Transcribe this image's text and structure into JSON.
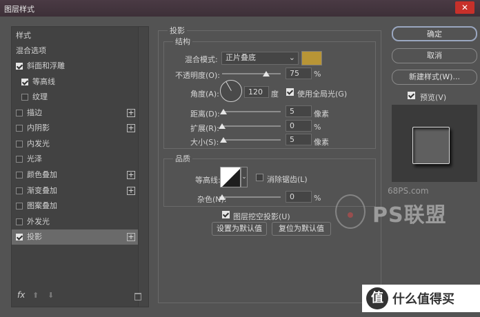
{
  "window": {
    "title": "图层样式",
    "close": "✕"
  },
  "left_panel": {
    "items": [
      {
        "label": "样式",
        "has_checkbox": false,
        "checked": false,
        "has_plus": false,
        "selected": false,
        "indent": 0
      },
      {
        "label": "混合选项",
        "has_checkbox": false,
        "checked": false,
        "has_plus": false,
        "selected": false,
        "indent": 0
      },
      {
        "label": "斜面和浮雕",
        "has_checkbox": true,
        "checked": true,
        "has_plus": false,
        "selected": false,
        "indent": 0
      },
      {
        "label": "等高线",
        "has_checkbox": true,
        "checked": true,
        "has_plus": false,
        "selected": false,
        "indent": 1
      },
      {
        "label": "纹理",
        "has_checkbox": true,
        "checked": false,
        "has_plus": false,
        "selected": false,
        "indent": 1
      },
      {
        "label": "描边",
        "has_checkbox": true,
        "checked": false,
        "has_plus": true,
        "selected": false,
        "indent": 0
      },
      {
        "label": "内阴影",
        "has_checkbox": true,
        "checked": false,
        "has_plus": true,
        "selected": false,
        "indent": 0
      },
      {
        "label": "内发光",
        "has_checkbox": true,
        "checked": false,
        "has_plus": false,
        "selected": false,
        "indent": 0
      },
      {
        "label": "光泽",
        "has_checkbox": true,
        "checked": false,
        "has_plus": false,
        "selected": false,
        "indent": 0
      },
      {
        "label": "颜色叠加",
        "has_checkbox": true,
        "checked": false,
        "has_plus": true,
        "selected": false,
        "indent": 0
      },
      {
        "label": "渐变叠加",
        "has_checkbox": true,
        "checked": false,
        "has_plus": true,
        "selected": false,
        "indent": 0
      },
      {
        "label": "图案叠加",
        "has_checkbox": true,
        "checked": false,
        "has_plus": false,
        "selected": false,
        "indent": 0
      },
      {
        "label": "外发光",
        "has_checkbox": true,
        "checked": false,
        "has_plus": false,
        "selected": false,
        "indent": 0
      },
      {
        "label": "投影",
        "has_checkbox": true,
        "checked": true,
        "has_plus": true,
        "selected": true,
        "indent": 0
      }
    ],
    "fx_label": "fx",
    "up": "⬆",
    "down": "⬇"
  },
  "drop_shadow": {
    "section_title": "投影",
    "structure": {
      "title": "结构",
      "blend_mode_label": "混合模式:",
      "blend_mode_value": "正片叠底",
      "color": "#b89536",
      "opacity_label": "不透明度(O):",
      "opacity_value": "75",
      "opacity_unit": "%",
      "opacity_fraction": 0.75,
      "angle_label": "角度(A):",
      "angle_value": "120",
      "angle_unit": "度",
      "global_light_label": "使用全局光(G)",
      "global_light_checked": true,
      "distance_label": "距离(D):",
      "distance_value": "5",
      "distance_unit": "像素",
      "distance_fraction": 0.02,
      "spread_label": "扩展(R):",
      "spread_value": "0",
      "spread_unit": "%",
      "spread_fraction": 0.0,
      "size_label": "大小(S):",
      "size_value": "5",
      "size_unit": "像素",
      "size_fraction": 0.02
    },
    "quality": {
      "title": "品质",
      "contour_label": "等高线:",
      "antialias_label": "消除锯齿(L)",
      "antialias_checked": false,
      "noise_label": "杂色(N):",
      "noise_value": "0",
      "noise_unit": "%",
      "noise_fraction": 0.0
    },
    "knockout_label": "图层挖空投影(U)",
    "knockout_checked": true,
    "set_default_label": "设置为默认值",
    "reset_default_label": "复位为默认值"
  },
  "right_panel": {
    "ok_label": "确定",
    "cancel_label": "取消",
    "new_style_label": "新建样式(W)...",
    "preview_label": "预览(V)",
    "preview_checked": true
  },
  "watermark": {
    "site": "68PS.com",
    "brand": "PS联盟"
  },
  "badge": {
    "icon": "值",
    "text": "什么值得买"
  }
}
